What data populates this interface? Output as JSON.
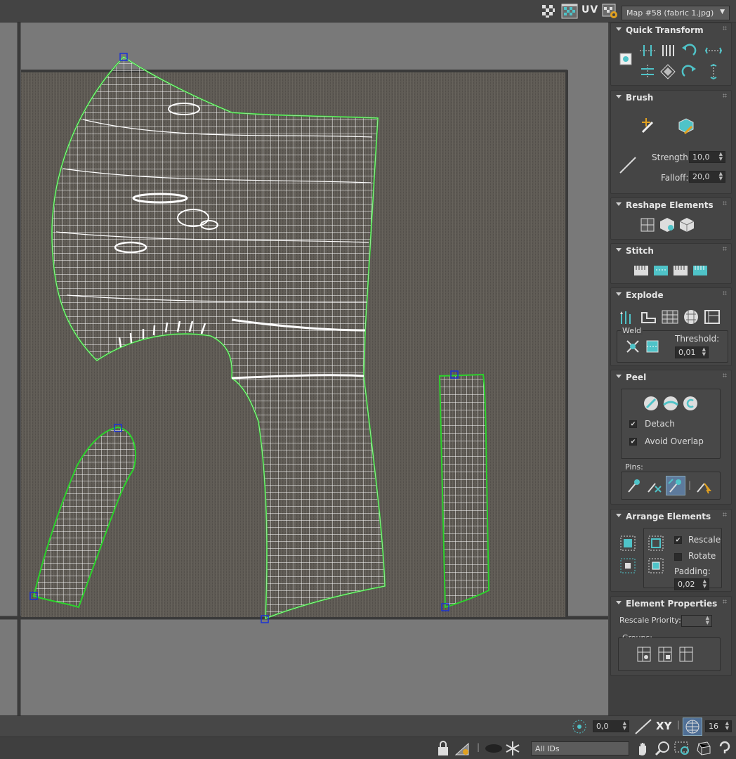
{
  "toolbar": {
    "uv_label": "UV",
    "map_select": "Map #58 (fabric 1.jpg)",
    "icons": [
      "checker-pattern-icon",
      "checker-map-icon",
      "texture-settings-icon"
    ]
  },
  "panel": {
    "quick_transform": {
      "title": "Quick Transform"
    },
    "brush": {
      "title": "Brush",
      "strength_label": "Strength:",
      "strength_value": "10,0",
      "falloff_label": "Falloff:",
      "falloff_value": "20,0"
    },
    "reshape": {
      "title": "Reshape Elements"
    },
    "stitch": {
      "title": "Stitch"
    },
    "explode": {
      "title": "Explode",
      "weld_label": "Weld",
      "threshold_label": "Threshold:",
      "threshold_value": "0,01"
    },
    "peel": {
      "title": "Peel",
      "detach_label": "Detach",
      "avoid_overlap_label": "Avoid Overlap",
      "pins_label": "Pins:"
    },
    "arrange": {
      "title": "Arrange Elements",
      "rescale_label": "Rescale",
      "rotate_label": "Rotate",
      "padding_label": "Padding:",
      "padding_value": "0,02"
    },
    "element_props": {
      "title": "Element Properties",
      "rescale_priority_label": "Rescale Priority:",
      "rescale_priority_value": "",
      "groups_label": "Groups:"
    }
  },
  "bottom": {
    "rotation_value": "0,0",
    "xy_label": "XY",
    "grid_value": "16",
    "ids_select": "All IDs"
  },
  "colors": {
    "accent": "#4fc3c8",
    "seam_green": "#2bd32b",
    "mesh_white": "#ffffff",
    "fabric": "#5d5953",
    "viewport_bg": "#797979",
    "pin_blue": "#1a33d6"
  }
}
